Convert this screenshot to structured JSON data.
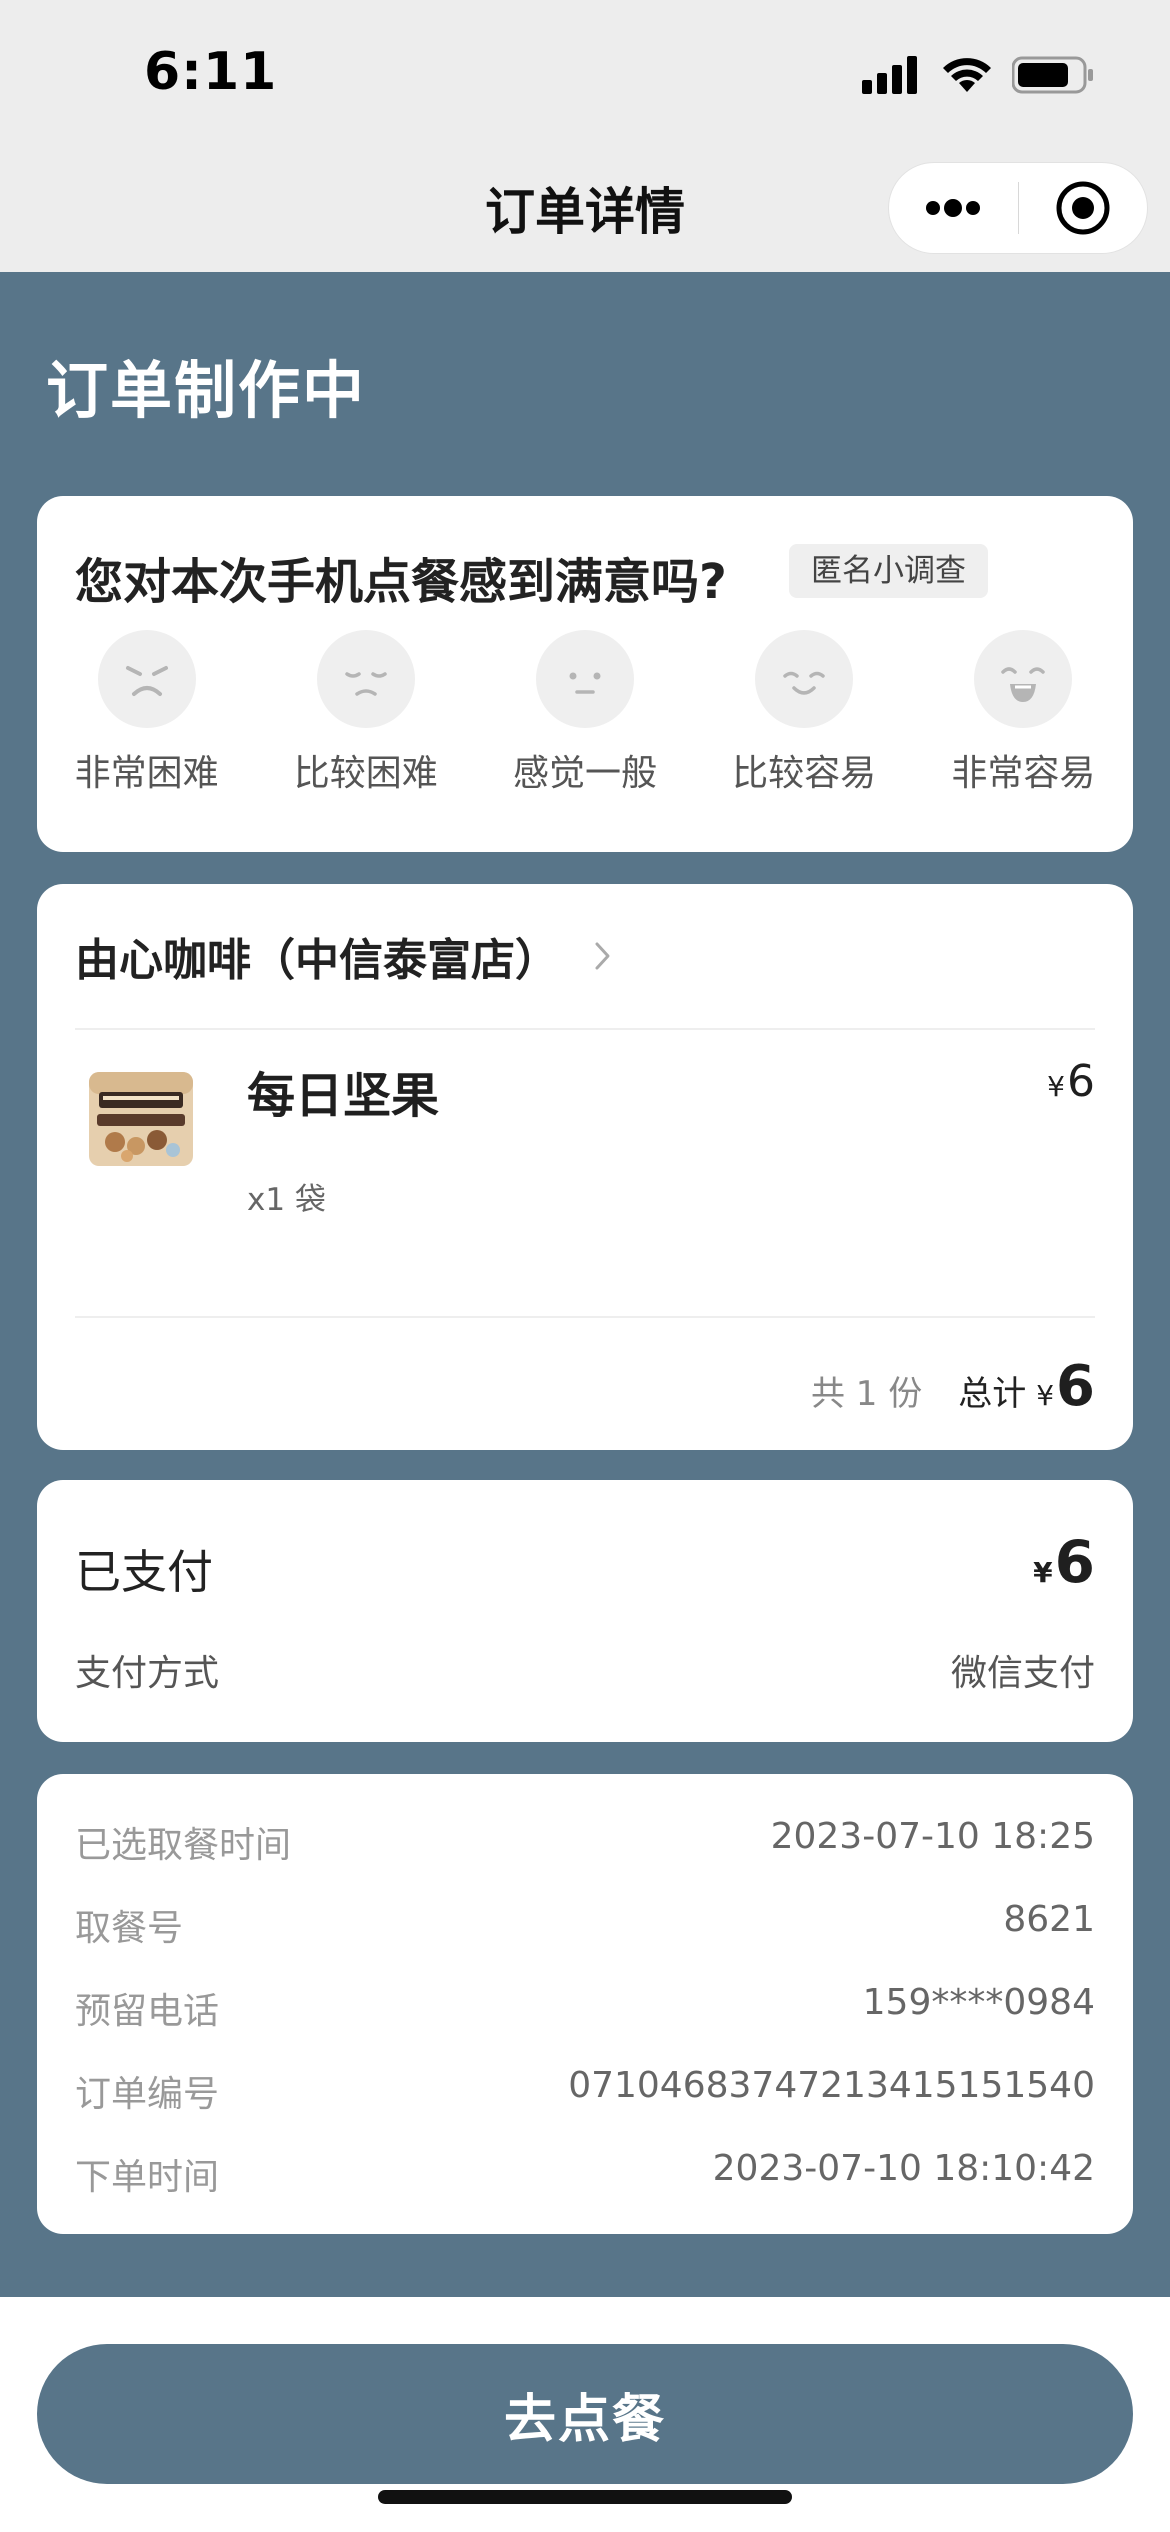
{
  "status_bar": {
    "time": "6:11"
  },
  "nav": {
    "title": "订单详情"
  },
  "header": {
    "title": "订单制作中"
  },
  "survey": {
    "question": "您对本次手机点餐感到满意吗?",
    "tag": "匿名小调查",
    "options": [
      {
        "label": "非常困难",
        "icon": "very-difficult-face-icon"
      },
      {
        "label": "比较困难",
        "icon": "difficult-face-icon"
      },
      {
        "label": "感觉一般",
        "icon": "neutral-face-icon"
      },
      {
        "label": "比较容易",
        "icon": "easy-face-icon"
      },
      {
        "label": "非常容易",
        "icon": "very-easy-face-icon"
      }
    ]
  },
  "order": {
    "store_name": "由心咖啡（中信泰富店）",
    "item": {
      "name": "每日坚果",
      "qty": "x1 袋",
      "currency": "¥",
      "price": "6"
    },
    "count_text": "共 1 份",
    "total_label": "总计",
    "total_currency": "¥",
    "total_value": "6"
  },
  "payment": {
    "status": "已支付",
    "currency": "¥",
    "amount": "6",
    "method_label": "支付方式",
    "method_value": "微信支付"
  },
  "info": [
    {
      "label": "已选取餐时间",
      "value": "2023-07-10 18:25"
    },
    {
      "label": "取餐号",
      "value": "8621"
    },
    {
      "label": "预留电话",
      "value": "159****0984"
    },
    {
      "label": "订单编号",
      "value": "07104683747213415151540"
    },
    {
      "label": "下单时间",
      "value": "2023-07-10 18:10:42"
    }
  ],
  "cta": {
    "label": "去点餐"
  },
  "colors": {
    "accent": "#587589",
    "background": "#ededed"
  }
}
